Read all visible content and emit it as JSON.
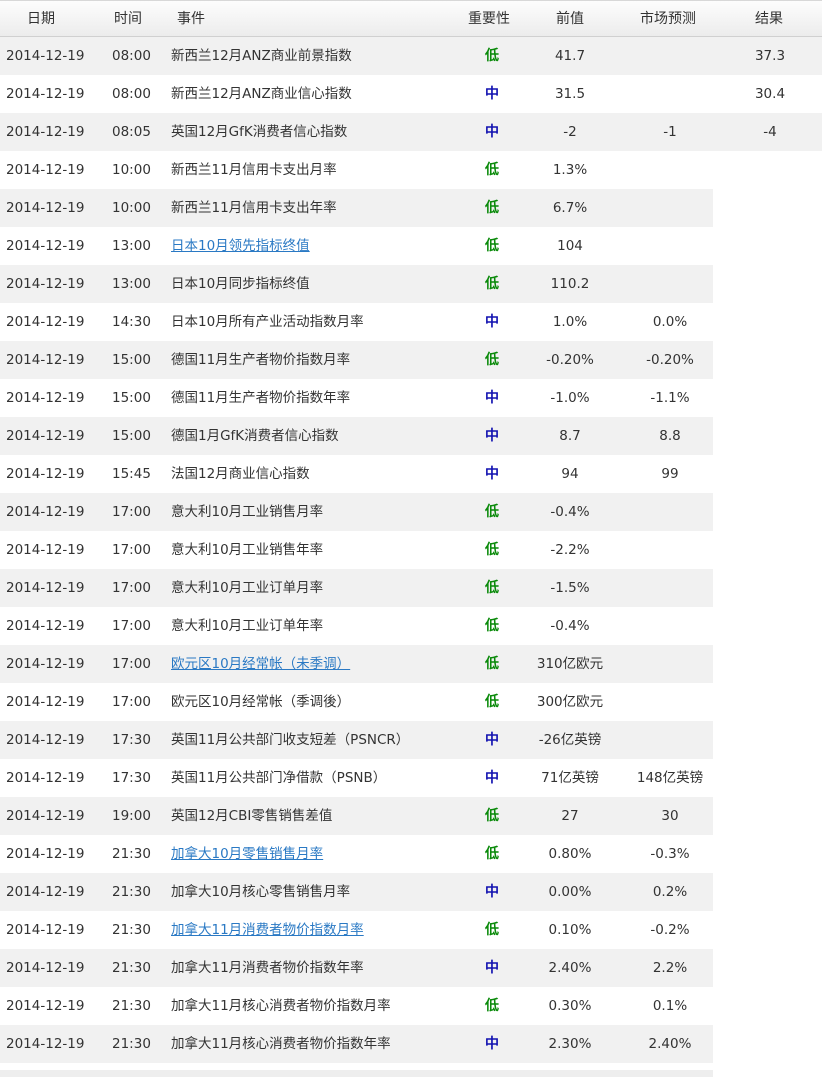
{
  "header": {
    "date": "日期",
    "time": "时间",
    "event": "事件",
    "importance": "重要性",
    "previous": "前值",
    "forecast": "市场预测",
    "result": "结果"
  },
  "colors": {
    "low": "#0a8a0a",
    "medium": "#1010b0",
    "link": "#2a79c4"
  },
  "rows": [
    {
      "date": "2014-12-19",
      "time": "08:00",
      "event": "新西兰12月ANZ商业前景指数",
      "link": false,
      "importance": "低",
      "level": "low",
      "previous": "41.7",
      "forecast": "",
      "result": "37.3"
    },
    {
      "date": "2014-12-19",
      "time": "08:00",
      "event": "新西兰12月ANZ商业信心指数",
      "link": false,
      "importance": "中",
      "level": "medium",
      "previous": "31.5",
      "forecast": "",
      "result": "30.4"
    },
    {
      "date": "2014-12-19",
      "time": "08:05",
      "event": "英国12月GfK消费者信心指数",
      "link": false,
      "importance": "中",
      "level": "medium",
      "previous": "-2",
      "forecast": "-1",
      "result": "-4"
    },
    {
      "date": "2014-12-19",
      "time": "10:00",
      "event": "新西兰11月信用卡支出月率",
      "link": false,
      "importance": "低",
      "level": "low",
      "previous": "1.3%",
      "forecast": "",
      "result": ""
    },
    {
      "date": "2014-12-19",
      "time": "10:00",
      "event": "新西兰11月信用卡支出年率",
      "link": false,
      "importance": "低",
      "level": "low",
      "previous": "6.7%",
      "forecast": "",
      "result": ""
    },
    {
      "date": "2014-12-19",
      "time": "13:00",
      "event": "日本10月领先指标终值",
      "link": true,
      "importance": "低",
      "level": "low",
      "previous": "104",
      "forecast": "",
      "result": ""
    },
    {
      "date": "2014-12-19",
      "time": "13:00",
      "event": "日本10月同步指标终值",
      "link": false,
      "importance": "低",
      "level": "low",
      "previous": "110.2",
      "forecast": "",
      "result": ""
    },
    {
      "date": "2014-12-19",
      "time": "14:30",
      "event": "日本10月所有产业活动指数月率",
      "link": false,
      "importance": "中",
      "level": "medium",
      "previous": "1.0%",
      "forecast": "0.0%",
      "result": ""
    },
    {
      "date": "2014-12-19",
      "time": "15:00",
      "event": "德国11月生产者物价指数月率",
      "link": false,
      "importance": "低",
      "level": "low",
      "previous": "-0.20%",
      "forecast": "-0.20%",
      "result": ""
    },
    {
      "date": "2014-12-19",
      "time": "15:00",
      "event": "德国11月生产者物价指数年率",
      "link": false,
      "importance": "中",
      "level": "medium",
      "previous": "-1.0%",
      "forecast": "-1.1%",
      "result": ""
    },
    {
      "date": "2014-12-19",
      "time": "15:00",
      "event": "德国1月GfK消费者信心指数",
      "link": false,
      "importance": "中",
      "level": "medium",
      "previous": "8.7",
      "forecast": "8.8",
      "result": ""
    },
    {
      "date": "2014-12-19",
      "time": "15:45",
      "event": "法国12月商业信心指数",
      "link": false,
      "importance": "中",
      "level": "medium",
      "previous": "94",
      "forecast": "99",
      "result": ""
    },
    {
      "date": "2014-12-19",
      "time": "17:00",
      "event": "意大利10月工业销售月率",
      "link": false,
      "importance": "低",
      "level": "low",
      "previous": "-0.4%",
      "forecast": "",
      "result": ""
    },
    {
      "date": "2014-12-19",
      "time": "17:00",
      "event": "意大利10月工业销售年率",
      "link": false,
      "importance": "低",
      "level": "low",
      "previous": "-2.2%",
      "forecast": "",
      "result": ""
    },
    {
      "date": "2014-12-19",
      "time": "17:00",
      "event": "意大利10月工业订单月率",
      "link": false,
      "importance": "低",
      "level": "low",
      "previous": "-1.5%",
      "forecast": "",
      "result": ""
    },
    {
      "date": "2014-12-19",
      "time": "17:00",
      "event": "意大利10月工业订单年率",
      "link": false,
      "importance": "低",
      "level": "low",
      "previous": "-0.4%",
      "forecast": "",
      "result": ""
    },
    {
      "date": "2014-12-19",
      "time": "17:00",
      "event": "欧元区10月经常帐（未季调）",
      "link": true,
      "importance": "低",
      "level": "low",
      "previous": "310亿欧元",
      "forecast": "",
      "result": ""
    },
    {
      "date": "2014-12-19",
      "time": "17:00",
      "event": "欧元区10月经常帐（季调後）",
      "link": false,
      "importance": "低",
      "level": "low",
      "previous": "300亿欧元",
      "forecast": "",
      "result": ""
    },
    {
      "date": "2014-12-19",
      "time": "17:30",
      "event": "英国11月公共部门收支短差（PSNCR）",
      "link": false,
      "importance": "中",
      "level": "medium",
      "previous": "-26亿英镑",
      "forecast": "",
      "result": ""
    },
    {
      "date": "2014-12-19",
      "time": "17:30",
      "event": "英国11月公共部门净借款（PSNB）",
      "link": false,
      "importance": "中",
      "level": "medium",
      "previous": "71亿英镑",
      "forecast": "148亿英镑",
      "result": ""
    },
    {
      "date": "2014-12-19",
      "time": "19:00",
      "event": "英国12月CBI零售销售差值",
      "link": false,
      "importance": "低",
      "level": "low",
      "previous": "27",
      "forecast": "30",
      "result": ""
    },
    {
      "date": "2014-12-19",
      "time": "21:30",
      "event": "加拿大10月零售销售月率",
      "link": true,
      "importance": "低",
      "level": "low",
      "previous": "0.80%",
      "forecast": "-0.3%",
      "result": ""
    },
    {
      "date": "2014-12-19",
      "time": "21:30",
      "event": "加拿大10月核心零售销售月率",
      "link": false,
      "importance": "中",
      "level": "medium",
      "previous": "0.00%",
      "forecast": "0.2%",
      "result": ""
    },
    {
      "date": "2014-12-19",
      "time": "21:30",
      "event": "加拿大11月消费者物价指数月率",
      "link": true,
      "importance": "低",
      "level": "low",
      "previous": "0.10%",
      "forecast": "-0.2%",
      "result": ""
    },
    {
      "date": "2014-12-19",
      "time": "21:30",
      "event": "加拿大11月消费者物价指数年率",
      "link": false,
      "importance": "中",
      "level": "medium",
      "previous": "2.40%",
      "forecast": "2.2%",
      "result": ""
    },
    {
      "date": "2014-12-19",
      "time": "21:30",
      "event": "加拿大11月核心消费者物价指数月率",
      "link": false,
      "importance": "低",
      "level": "low",
      "previous": "0.30%",
      "forecast": "0.1%",
      "result": ""
    },
    {
      "date": "2014-12-19",
      "time": "21:30",
      "event": "加拿大11月核心消费者物价指数年率",
      "link": false,
      "importance": "中",
      "level": "medium",
      "previous": "2.30%",
      "forecast": "2.40%",
      "result": ""
    }
  ]
}
